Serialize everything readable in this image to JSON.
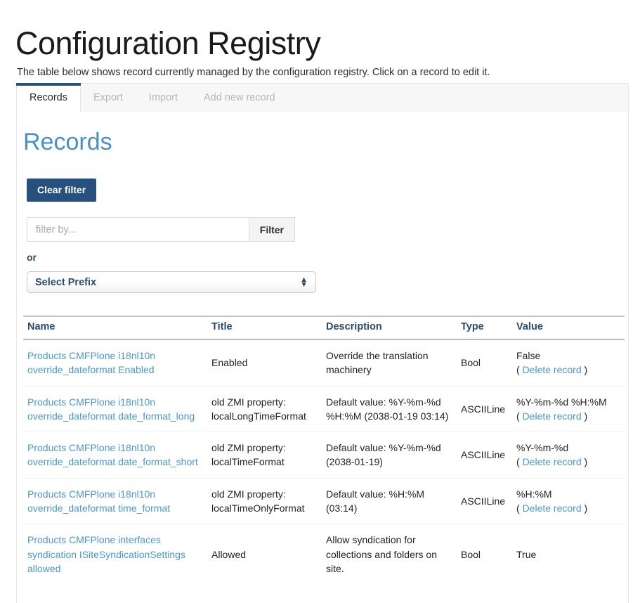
{
  "header": {
    "title": "Configuration Registry",
    "description": "The table below shows record currently managed by the configuration registry. Click on a record to edit it."
  },
  "tabs": [
    {
      "label": "Records",
      "active": true
    },
    {
      "label": "Export",
      "active": false
    },
    {
      "label": "Import",
      "active": false
    },
    {
      "label": "Add new record",
      "active": false
    }
  ],
  "panel": {
    "section_heading": "Records",
    "clear_filter_label": "Clear filter",
    "filter_placeholder": "filter by...",
    "filter_value": "",
    "filter_button_label": "Filter",
    "or_label": "or",
    "prefix_select_value": "Select Prefix",
    "prefix_select_up_arrow": "▲",
    "prefix_select_down_arrow": "▼"
  },
  "table": {
    "columns": [
      "Name",
      "Title",
      "Description",
      "Type",
      "Value"
    ],
    "delete_label": "Delete record",
    "delete_open_paren": "(",
    "delete_close_paren": ")",
    "rows": [
      {
        "name": "Products CMFPlone i18nl10n override_dateformat Enabled",
        "title": "Enabled",
        "description": "Override the translation machinery",
        "type": "Bool",
        "value": "False",
        "has_delete": true
      },
      {
        "name": "Products CMFPlone i18nl10n override_dateformat date_format_long",
        "title": "old ZMI property: localLongTimeFormat",
        "description": "Default value: %Y-%m-%d %H:%M (2038-01-19 03:14)",
        "type": "ASCIILine",
        "value": "%Y-%m-%d %H:%M",
        "has_delete": true
      },
      {
        "name": "Products CMFPlone i18nl10n override_dateformat date_format_short",
        "title": "old ZMI property: localTimeFormat",
        "description": "Default value: %Y-%m-%d (2038-01-19)",
        "type": "ASCIILine",
        "value": "%Y-%m-%d",
        "has_delete": true
      },
      {
        "name": "Products CMFPlone i18nl10n override_dateformat time_format",
        "title": "old ZMI property: localTimeOnlyFormat",
        "description": "Default value: %H:%M (03:14)",
        "type": "ASCIILine",
        "value": "%H:%M",
        "has_delete": true
      },
      {
        "name": "Products CMFPlone interfaces syndication ISiteSyndicationSettings allowed",
        "title": "Allowed",
        "description": "Allow syndication for collections and folders on site.",
        "type": "Bool",
        "value": "True",
        "has_delete": false
      }
    ]
  }
}
